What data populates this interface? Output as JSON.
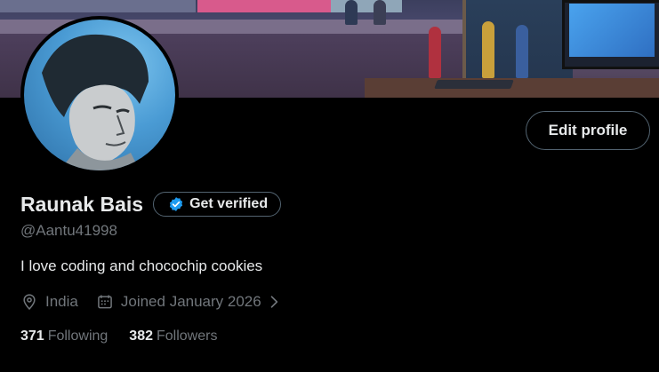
{
  "profile": {
    "name": "Raunak Bais",
    "handle": "@Aantu41998",
    "bio": "I love coding and chocochip cookies",
    "location": "India",
    "joined": "Joined January 2026"
  },
  "buttons": {
    "edit_profile": "Edit profile",
    "get_verified": "Get verified"
  },
  "stats": {
    "following_count": "371",
    "following_label": "Following",
    "followers_count": "382",
    "followers_label": "Followers"
  },
  "icons": {
    "verified": "verified-badge-icon",
    "location": "location-pin-icon",
    "calendar": "calendar-icon",
    "chevron": "chevron-right-icon"
  },
  "colors": {
    "background": "#000000",
    "primary_text": "#e7e9ea",
    "secondary_text": "#71767b",
    "border": "#536471",
    "verified_blue": "#1d9bf0"
  }
}
